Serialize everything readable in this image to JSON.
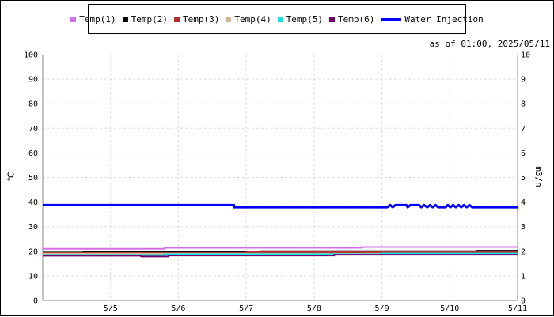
{
  "chart_data": {
    "type": "line",
    "subtitle": "as of 01:00, 2025/05/11",
    "left_axis": {
      "label": "℃",
      "ylim": [
        0,
        100
      ],
      "ticks": [
        0,
        10,
        20,
        30,
        40,
        50,
        60,
        70,
        80,
        90,
        100
      ]
    },
    "right_axis": {
      "label": "m3/h",
      "ylim": [
        0,
        10
      ],
      "ticks": [
        0,
        1,
        2,
        3,
        4,
        5,
        6,
        7,
        8,
        9,
        10
      ]
    },
    "x_axis": {
      "tick_labels": [
        "5/5",
        "5/6",
        "5/7",
        "5/8",
        "5/9",
        "5/10",
        "5/11"
      ],
      "range_days": [
        4.0,
        11.0
      ],
      "tick_days": [
        5,
        6,
        7,
        8,
        9,
        10,
        11
      ]
    },
    "grid": true,
    "legend_position": "top-center",
    "series": [
      {
        "name": "Temp(1)",
        "axis": "left",
        "color": "#d070e8",
        "points": [
          [
            4.0,
            21.0
          ],
          [
            5.8,
            21.0
          ],
          [
            5.8,
            21.4
          ],
          [
            8.7,
            21.4
          ],
          [
            8.7,
            21.7
          ],
          [
            11.0,
            21.7
          ]
        ]
      },
      {
        "name": "Temp(2)",
        "axis": "left",
        "color": "#000000",
        "points": [
          [
            4.0,
            19.5
          ],
          [
            4.6,
            19.5
          ],
          [
            4.6,
            19.8
          ],
          [
            7.2,
            19.8
          ],
          [
            7.2,
            20.0
          ],
          [
            10.4,
            20.0
          ],
          [
            10.4,
            20.2
          ],
          [
            11.0,
            20.2
          ]
        ]
      },
      {
        "name": "Temp(3)",
        "axis": "left",
        "color": "#b03030",
        "points": [
          [
            4.0,
            19.3
          ],
          [
            7.0,
            19.3
          ],
          [
            7.0,
            19.6
          ],
          [
            11.0,
            19.6
          ]
        ]
      },
      {
        "name": "Temp(4)",
        "axis": "left",
        "color": "#d0b890",
        "points": [
          [
            4.0,
            19.0
          ],
          [
            11.0,
            19.0
          ]
        ]
      },
      {
        "name": "Temp(5)",
        "axis": "left",
        "color": "#00e8e8",
        "points": [
          [
            4.0,
            18.5
          ],
          [
            5.8,
            18.5
          ],
          [
            5.8,
            18.8
          ],
          [
            9.0,
            18.8
          ],
          [
            9.0,
            19.1
          ],
          [
            11.0,
            19.1
          ]
        ]
      },
      {
        "name": "Temp(6)",
        "axis": "left",
        "color": "#700070",
        "points": [
          [
            4.0,
            18.2
          ],
          [
            5.45,
            18.2
          ],
          [
            5.45,
            17.9
          ],
          [
            5.85,
            17.9
          ],
          [
            5.85,
            18.3
          ],
          [
            8.3,
            18.3
          ],
          [
            8.3,
            18.6
          ],
          [
            11.0,
            18.6
          ]
        ]
      },
      {
        "name": "Water Injection",
        "axis": "right",
        "color": "#0000ff",
        "points": [
          [
            4.0,
            3.88
          ],
          [
            6.82,
            3.88
          ],
          [
            6.82,
            3.79
          ],
          [
            9.08,
            3.79
          ],
          [
            9.12,
            3.88
          ],
          [
            9.16,
            3.79
          ],
          [
            9.2,
            3.88
          ],
          [
            9.36,
            3.88
          ],
          [
            9.38,
            3.79
          ],
          [
            9.42,
            3.88
          ],
          [
            9.55,
            3.88
          ],
          [
            9.58,
            3.79
          ],
          [
            9.62,
            3.88
          ],
          [
            9.67,
            3.79
          ],
          [
            9.71,
            3.88
          ],
          [
            9.75,
            3.79
          ],
          [
            9.79,
            3.88
          ],
          [
            9.83,
            3.79
          ],
          [
            9.94,
            3.79
          ],
          [
            9.97,
            3.88
          ],
          [
            10.01,
            3.79
          ],
          [
            10.05,
            3.88
          ],
          [
            10.09,
            3.79
          ],
          [
            10.13,
            3.88
          ],
          [
            10.17,
            3.79
          ],
          [
            10.21,
            3.88
          ],
          [
            10.25,
            3.79
          ],
          [
            10.29,
            3.88
          ],
          [
            10.33,
            3.79
          ],
          [
            11.0,
            3.79
          ]
        ]
      }
    ]
  }
}
